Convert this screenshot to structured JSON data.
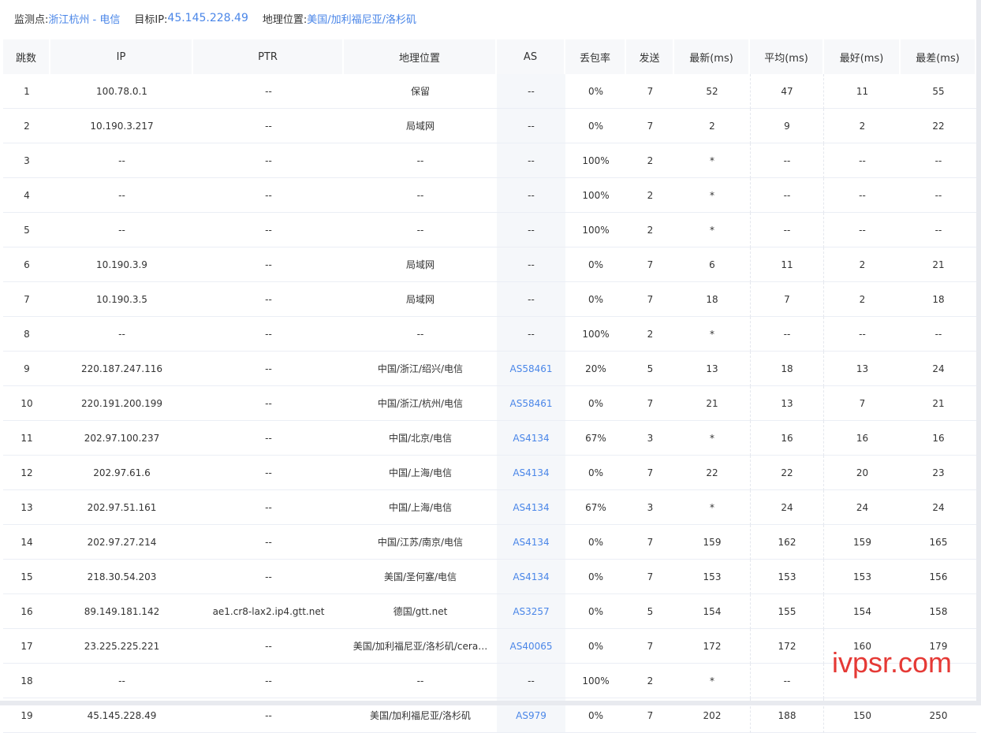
{
  "header": {
    "probe_label": "监测点:",
    "probe_value": "浙江杭州 - 电信",
    "target_label": "目标IP:",
    "target_value": "45.145.228.49",
    "geo_label": "地理位置:",
    "geo_value": "美国/加利福尼亚/洛杉矶"
  },
  "columns": [
    "跳数",
    "IP",
    "PTR",
    "地理位置",
    "AS",
    "丢包率",
    "发送",
    "最新(ms)",
    "平均(ms)",
    "最好(ms)",
    "最差(ms)"
  ],
  "rows": [
    [
      "1",
      "100.78.0.1",
      "--",
      "保留",
      "--",
      "0%",
      "7",
      "52",
      "47",
      "11",
      "55"
    ],
    [
      "2",
      "10.190.3.217",
      "--",
      "局域网",
      "--",
      "0%",
      "7",
      "2",
      "9",
      "2",
      "22"
    ],
    [
      "3",
      "--",
      "--",
      "--",
      "--",
      "100%",
      "2",
      "*",
      "--",
      "--",
      "--"
    ],
    [
      "4",
      "--",
      "--",
      "--",
      "--",
      "100%",
      "2",
      "*",
      "--",
      "--",
      "--"
    ],
    [
      "5",
      "--",
      "--",
      "--",
      "--",
      "100%",
      "2",
      "*",
      "--",
      "--",
      "--"
    ],
    [
      "6",
      "10.190.3.9",
      "--",
      "局域网",
      "--",
      "0%",
      "7",
      "6",
      "11",
      "2",
      "21"
    ],
    [
      "7",
      "10.190.3.5",
      "--",
      "局域网",
      "--",
      "0%",
      "7",
      "18",
      "7",
      "2",
      "18"
    ],
    [
      "8",
      "--",
      "--",
      "--",
      "--",
      "100%",
      "2",
      "*",
      "--",
      "--",
      "--"
    ],
    [
      "9",
      "220.187.247.116",
      "--",
      "中国/浙江/绍兴/电信",
      "AS58461",
      "20%",
      "5",
      "13",
      "18",
      "13",
      "24"
    ],
    [
      "10",
      "220.191.200.199",
      "--",
      "中国/浙江/杭州/电信",
      "AS58461",
      "0%",
      "7",
      "21",
      "13",
      "7",
      "21"
    ],
    [
      "11",
      "202.97.100.237",
      "--",
      "中国/北京/电信",
      "AS4134",
      "67%",
      "3",
      "*",
      "16",
      "16",
      "16"
    ],
    [
      "12",
      "202.97.61.6",
      "--",
      "中国/上海/电信",
      "AS4134",
      "0%",
      "7",
      "22",
      "22",
      "20",
      "23"
    ],
    [
      "13",
      "202.97.51.161",
      "--",
      "中国/上海/电信",
      "AS4134",
      "67%",
      "3",
      "*",
      "24",
      "24",
      "24"
    ],
    [
      "14",
      "202.97.27.214",
      "--",
      "中国/江苏/南京/电信",
      "AS4134",
      "0%",
      "7",
      "159",
      "162",
      "159",
      "165"
    ],
    [
      "15",
      "218.30.54.203",
      "--",
      "美国/圣何塞/电信",
      "AS4134",
      "0%",
      "7",
      "153",
      "153",
      "153",
      "156"
    ],
    [
      "16",
      "89.149.181.142",
      "ae1.cr8-lax2.ip4.gtt.net",
      "德国/gtt.net",
      "AS3257",
      "0%",
      "5",
      "154",
      "155",
      "154",
      "158"
    ],
    [
      "17",
      "23.225.225.221",
      "--",
      "美国/加利福尼亚/洛杉矶/cera…",
      "AS40065",
      "0%",
      "7",
      "172",
      "172",
      "160",
      "179"
    ],
    [
      "18",
      "--",
      "--",
      "--",
      "--",
      "100%",
      "2",
      "*",
      "--",
      "",
      ""
    ],
    [
      "19",
      "45.145.228.49",
      "--",
      "美国/加利福尼亚/洛杉矶",
      "AS979",
      "0%",
      "7",
      "202",
      "188",
      "150",
      "250"
    ]
  ],
  "watermark": "ivpsr.com",
  "colors": {
    "link": "#4a86e8",
    "header_bg": "#f7f8fa",
    "watermark": "#e53935"
  }
}
